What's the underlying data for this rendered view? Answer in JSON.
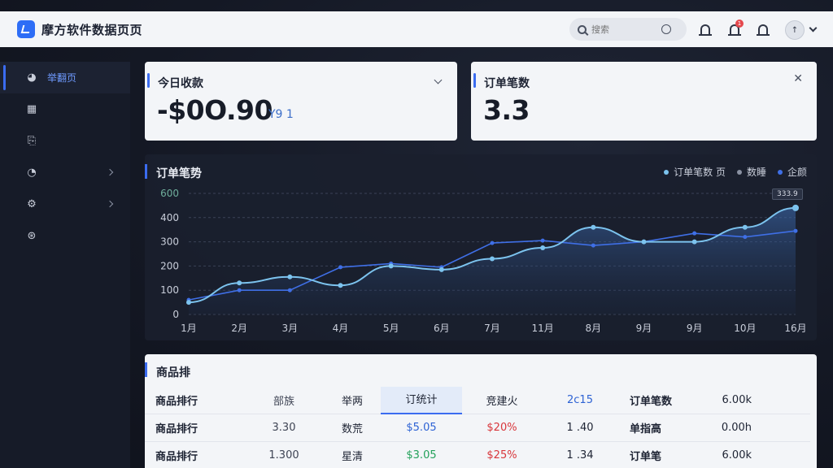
{
  "app": {
    "title": "摩方软件数据页页"
  },
  "header": {
    "search_placeholder": "搜索",
    "notification_badge": "1",
    "avatar_text": "↑"
  },
  "sidebar": {
    "items": [
      {
        "label": "举翻页",
        "icon": "dashboard-icon",
        "active": true
      },
      {
        "label": "",
        "icon": "grid-icon"
      },
      {
        "label": "",
        "icon": "document-icon"
      },
      {
        "label": "",
        "icon": "pie-icon",
        "has_arrow": true
      },
      {
        "label": "",
        "icon": "gear-icon",
        "has_arrow": true
      },
      {
        "label": "",
        "icon": "globe-icon"
      }
    ]
  },
  "kpis": [
    {
      "title": "今日收款",
      "value": "-$0O.90",
      "sub": "Y9 1"
    },
    {
      "title": "订单笔数",
      "value": "3.3"
    }
  ],
  "chart_panel": {
    "title": "订单笔势",
    "tooltip": "333.9",
    "legend": [
      "订单笔数 页",
      "数睡",
      "企颜"
    ]
  },
  "chart_data": {
    "type": "line",
    "x": [
      "1月",
      "2月",
      "3月",
      "4月",
      "5月",
      "6月",
      "7月",
      "11月",
      "8月",
      "9月",
      "9月",
      "10月",
      "16月"
    ],
    "ylim": [
      0,
      500
    ],
    "yticks": [
      "0",
      "100",
      "200",
      "300",
      "400",
      "600"
    ],
    "series": [
      {
        "name": "订单笔数 页",
        "color": "#7cc3ee",
        "values": [
          50,
          130,
          155,
          120,
          200,
          185,
          230,
          275,
          360,
          300,
          300,
          360,
          440
        ]
      },
      {
        "name": "企颜",
        "color": "#3f6fe6",
        "values": [
          60,
          100,
          100,
          195,
          210,
          195,
          295,
          305,
          285,
          300,
          335,
          320,
          345
        ]
      }
    ]
  },
  "table": {
    "title": "商品排",
    "header": [
      "商品排行",
      "部族",
      "举两",
      "订统计",
      "竞建火",
      "2c15",
      "订单笔数",
      "6.00k"
    ],
    "rows": [
      [
        "商品排行",
        "3.30",
        "数荒",
        "$5.05",
        "$20%",
        "1 .40",
        "单指高",
        "0.00h"
      ],
      [
        "商品排行",
        "1.300",
        "星清",
        "$3.05",
        "$25%",
        "1 .34",
        "订单笔",
        "6.00k"
      ]
    ]
  },
  "colors": {
    "accent": "#3b6cf0",
    "line1": "#7cc3ee",
    "line2": "#3f6fe6"
  }
}
